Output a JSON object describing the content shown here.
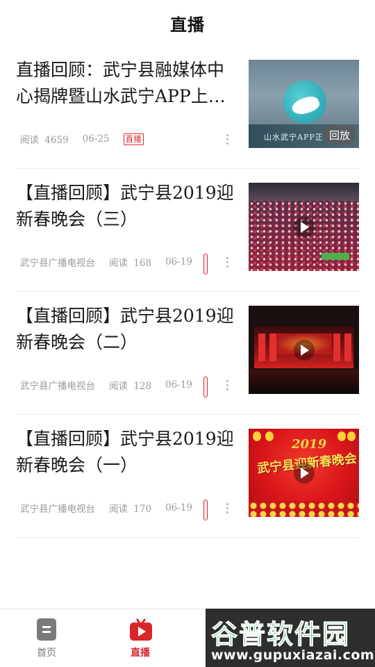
{
  "header": {
    "title": "直播"
  },
  "articles": [
    {
      "title": "直播回顾：武宁县融媒体中心揭牌暨山水武宁APP上…",
      "read_label": "阅读",
      "read_count": "4659",
      "date": "06-25",
      "badge": "直播",
      "thumb_caption": "山水武宁APP正",
      "thumb_button": "回放"
    },
    {
      "title": "【直播回顾】武宁县2019迎新春晚会（三）",
      "source": "武宁县广播电视台",
      "read_label": "阅读",
      "read_count": "168",
      "date": "06-19"
    },
    {
      "title": "【直播回顾】武宁县2019迎新春晚会（二）",
      "source": "武宁县广播电视台",
      "read_label": "阅读",
      "read_count": "128",
      "date": "06-19"
    },
    {
      "title": "【直播回顾】武宁县2019迎新春晚会（一）",
      "source": "武宁县广播电视台",
      "read_label": "阅读",
      "read_count": "170",
      "date": "06-19",
      "thumb_year": "2019",
      "thumb_headline": "武宁县迎新春晚会"
    }
  ],
  "tabbar": {
    "tabs": [
      {
        "label": "首页",
        "icon": "document-icon",
        "active": false
      },
      {
        "label": "直播",
        "icon": "tv-play-icon",
        "active": true
      }
    ],
    "accent_color": "#d9262c"
  },
  "watermark": {
    "text": "谷普软件园",
    "url": "www.gupuxiazai.com"
  }
}
